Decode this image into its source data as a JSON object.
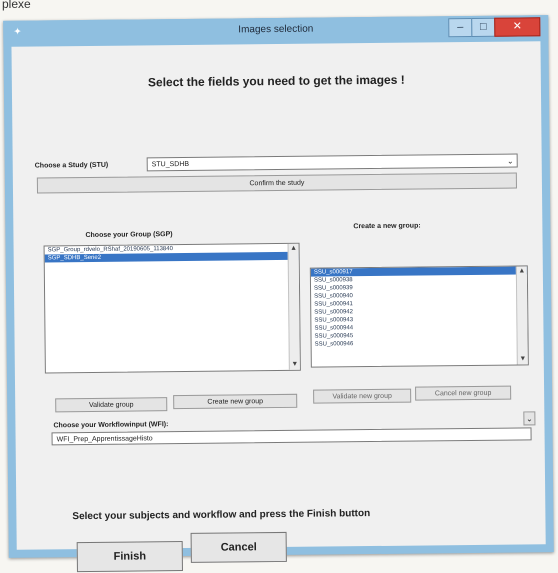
{
  "doc_fragment": "plexe",
  "window": {
    "title": "Images selection",
    "controls": {
      "minimize": "–",
      "maximize": "□",
      "close": "✕"
    }
  },
  "heading": "Select the fields you need to get the images !",
  "study": {
    "label": "Choose a Study (STU)",
    "value": "STU_SDHB",
    "confirm_label": "Confirm the study"
  },
  "group": {
    "label": "Choose your Group (SGP)",
    "items": [
      "SGP_Group_rdvelo_RShaf_20190605_113840",
      "SGP_SDHB_Serie2"
    ],
    "selected_index": 1,
    "validate_label": "Validate group",
    "create_label": "Create new group"
  },
  "new_group": {
    "label": "Create a new group:",
    "items": [
      "SSU_s000917",
      "SSU_s000938",
      "SSU_s000939",
      "SSU_s000940",
      "SSU_s000941",
      "SSU_s000942",
      "SSU_s000943",
      "SSU_s000944",
      "SSU_s000945",
      "SSU_s000946"
    ],
    "selected_index": 0,
    "validate_label": "Validate new group",
    "cancel_label": "Cancel new group"
  },
  "workflow": {
    "label": "Choose your Workflowinput (WFI):",
    "value": "WFI_Prep_ApprentissageHisto"
  },
  "footer": {
    "instruction": "Select your subjects and workflow and press the Finish button",
    "finish_label": "Finish",
    "cancel_label": "Cancel"
  }
}
